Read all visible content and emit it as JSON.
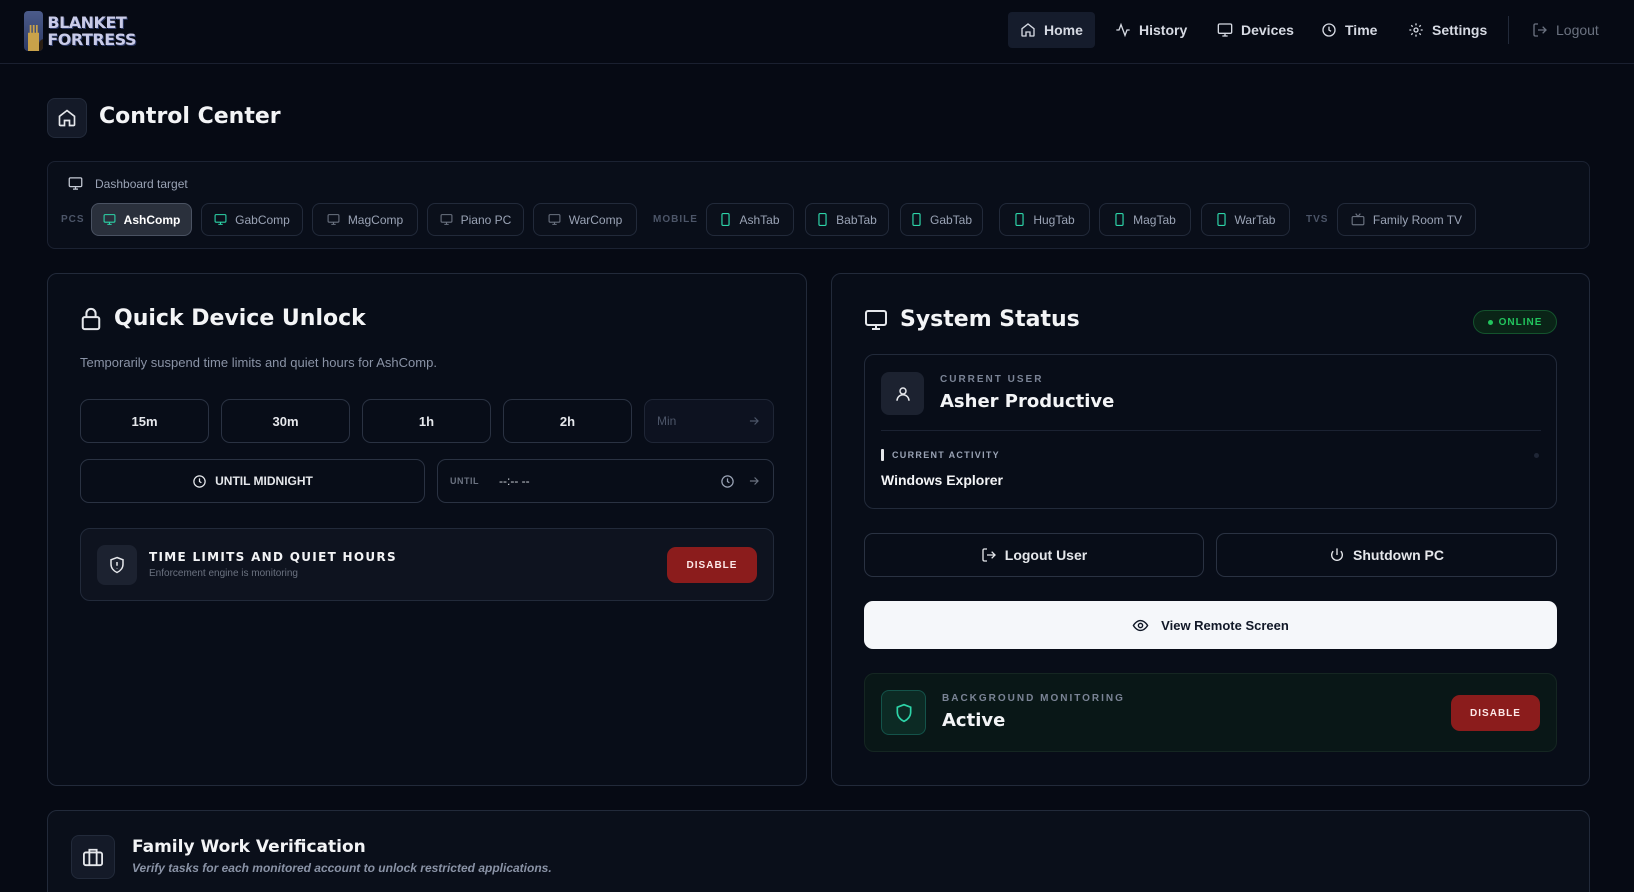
{
  "logo": {
    "line1": "BLANKET",
    "line2": "FORTRESS"
  },
  "nav": {
    "items": [
      {
        "label": "Home",
        "icon": "home-icon"
      },
      {
        "label": "History",
        "icon": "activity-icon"
      },
      {
        "label": "Devices",
        "icon": "monitor-icon"
      },
      {
        "label": "Time",
        "icon": "clock-icon"
      },
      {
        "label": "Settings",
        "icon": "gear-icon"
      }
    ],
    "logout_label": "Logout",
    "active": "Home"
  },
  "page": {
    "title": "Control Center"
  },
  "target": {
    "label": "Dashboard target",
    "groups": [
      {
        "label": "PCS",
        "devices": [
          "AshComp",
          "GabComp",
          "MagComp",
          "Piano PC",
          "WarComp"
        ]
      },
      {
        "label": "MOBILE",
        "devices": [
          "AshTab",
          "BabTab",
          "GabTab",
          "HugTab",
          "MagTab",
          "WarTab"
        ]
      },
      {
        "label": "TVS",
        "devices": [
          "Family Room TV"
        ]
      }
    ],
    "selected": "AshComp"
  },
  "unlock": {
    "title": "Quick Device Unlock",
    "subtitle": "Temporarily suspend time limits and quiet hours for AshComp.",
    "durations": [
      "15m",
      "30m",
      "1h",
      "2h"
    ],
    "min_placeholder": "Min",
    "until_midnight": "UNTIL MIDNIGHT",
    "until_label": "UNTIL",
    "until_value": "--:-- --",
    "limits_title": "TIME LIMITS AND QUIET HOURS",
    "limits_sub": "Enforcement engine is monitoring",
    "disable_label": "DISABLE"
  },
  "status": {
    "title": "System Status",
    "badge": "ONLINE",
    "current_user_label": "CURRENT USER",
    "current_user": "Asher Productive",
    "current_activity_label": "CURRENT ACTIVITY",
    "current_activity": "Windows Explorer",
    "logout_user": "Logout User",
    "shutdown": "Shutdown PC",
    "remote": "View Remote Screen",
    "bg_label": "BACKGROUND MONITORING",
    "bg_value": "Active",
    "disable_label": "DISABLE"
  },
  "family": {
    "title": "Family Work Verification",
    "subtitle": "Verify tasks for each monitored account to unlock restricted applications."
  },
  "colors": {
    "background": "#060a14",
    "accent_green": "#22c55e",
    "danger": "#8b1c1c",
    "teal_icon": "#2dd4a8"
  }
}
